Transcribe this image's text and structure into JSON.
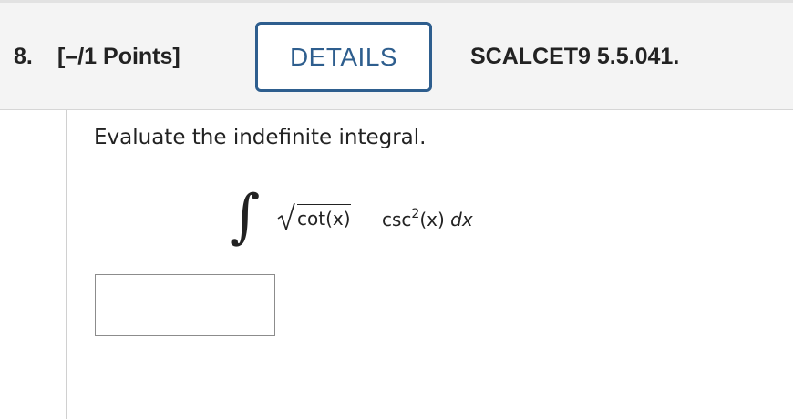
{
  "question": {
    "number": "8.",
    "points": "[–/1 Points]",
    "details_label": "DETAILS",
    "reference": "SCALCET9 5.5.041."
  },
  "body": {
    "prompt": "Evaluate the indefinite integral.",
    "integral": {
      "sign": "∫",
      "radicand": "cot(x)",
      "trig": "csc",
      "exponent": "2",
      "argument": "(x)",
      "differential": "dx"
    },
    "answer": {
      "value": "",
      "placeholder": ""
    }
  },
  "colors": {
    "accent": "#2e5e8e",
    "header_bg": "#f4f4f4",
    "text": "#222222"
  }
}
